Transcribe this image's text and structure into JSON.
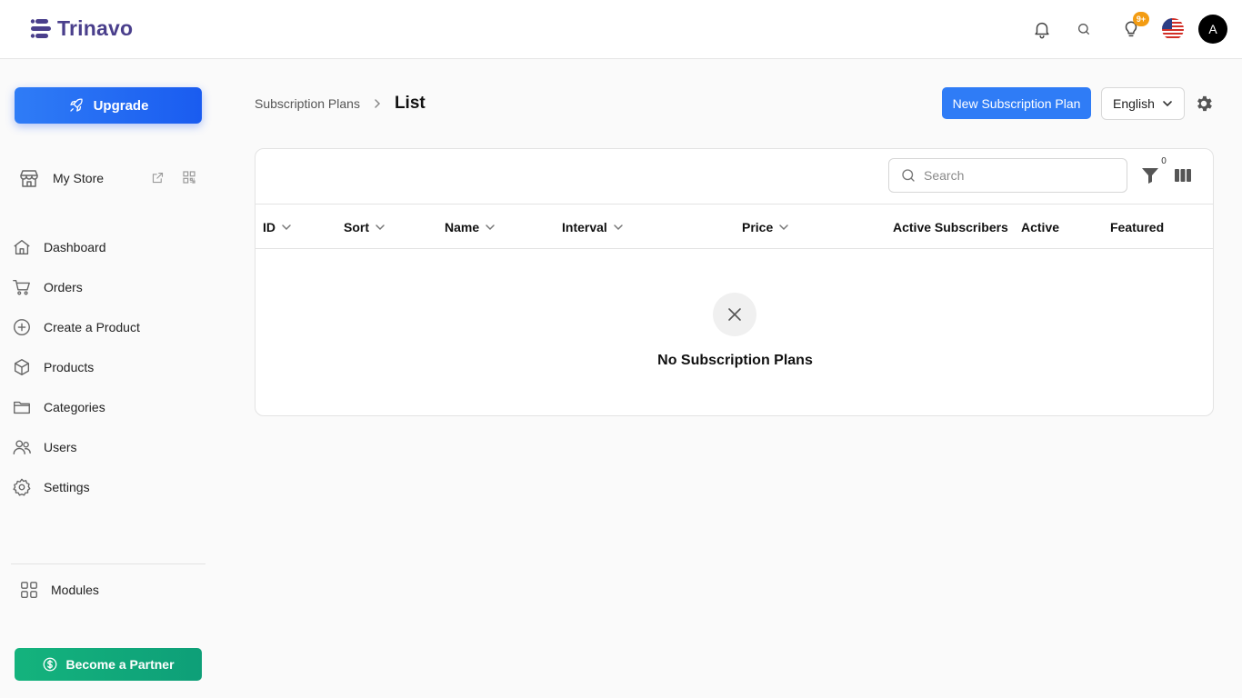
{
  "brand": {
    "name": "Trinavo",
    "color": "#4a3f8c"
  },
  "header": {
    "notification_icon": "bell-icon",
    "search_icon": "search-icon",
    "ideas_icon": "lightbulb-icon",
    "ideas_badge": "9+",
    "language_flag": "us-flag-icon",
    "avatar_initial": "A"
  },
  "sidebar": {
    "upgrade_label": "Upgrade",
    "store_label": "My Store",
    "items": [
      {
        "label": "Dashboard",
        "icon": "home-icon"
      },
      {
        "label": "Orders",
        "icon": "cart-icon"
      },
      {
        "label": "Create a Product",
        "icon": "plus-circle-icon"
      },
      {
        "label": "Products",
        "icon": "box-icon"
      },
      {
        "label": "Categories",
        "icon": "folder-icon"
      },
      {
        "label": "Users",
        "icon": "users-icon"
      },
      {
        "label": "Settings",
        "icon": "gear-icon"
      }
    ],
    "modules_label": "Modules",
    "partner_label": "Become a Partner"
  },
  "page": {
    "breadcrumb_parent": "Subscription Plans",
    "breadcrumb_current": "List",
    "new_button_label": "New Subscription Plan",
    "language_selected": "English"
  },
  "table": {
    "search_placeholder": "Search",
    "filter_count": "0",
    "columns": [
      {
        "label": "ID",
        "sortable": true
      },
      {
        "label": "Sort",
        "sortable": true
      },
      {
        "label": "Name",
        "sortable": true
      },
      {
        "label": "Interval",
        "sortable": true
      },
      {
        "label": "Price",
        "sortable": true
      },
      {
        "label": "Active Subscribers",
        "sortable": false
      },
      {
        "label": "Active",
        "sortable": false
      },
      {
        "label": "Featured",
        "sortable": false
      }
    ],
    "rows": [],
    "empty_message": "No Subscription Plans"
  },
  "colors": {
    "primary": "#2f7cf6",
    "partner": "#10a97a",
    "badge": "#f39c12"
  }
}
